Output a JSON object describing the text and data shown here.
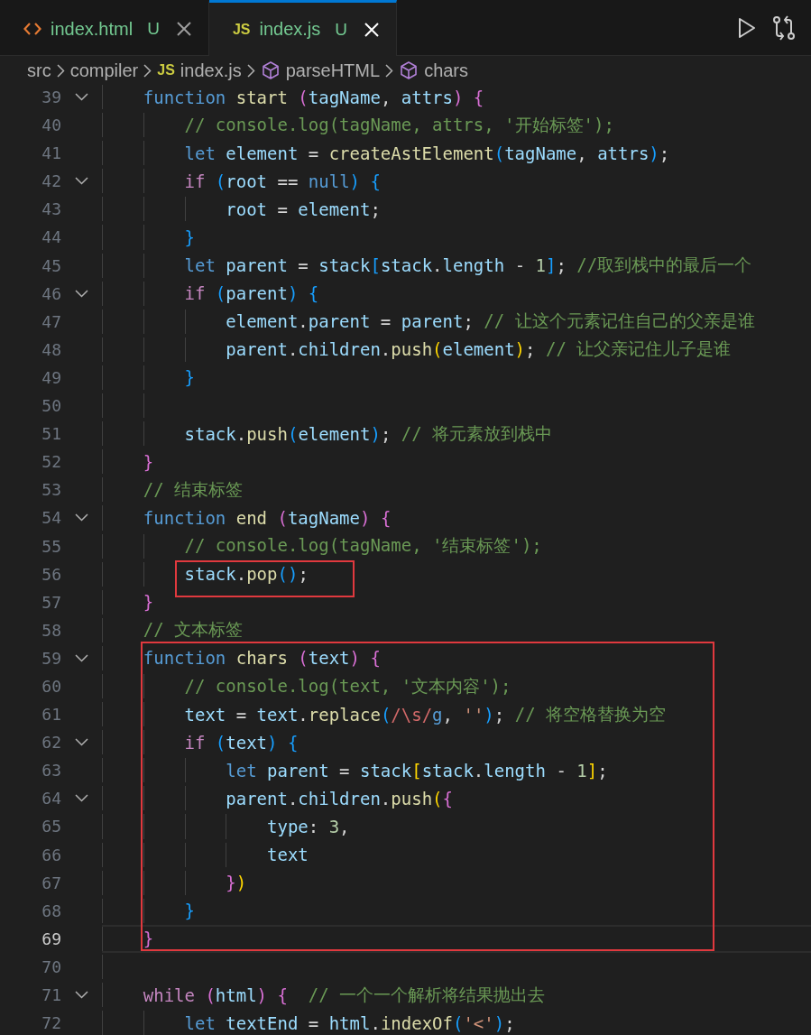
{
  "tabs": [
    {
      "kind": "html",
      "label": "index.html",
      "status": "U",
      "selected": false
    },
    {
      "kind": "js",
      "badge": "JS",
      "label": "index.js",
      "status": "U",
      "selected": true
    }
  ],
  "breadcrumb": [
    {
      "kind": "folder",
      "label": "src"
    },
    {
      "kind": "folder",
      "label": "compiler"
    },
    {
      "kind": "js",
      "badge": "JS",
      "label": "index.js"
    },
    {
      "kind": "symbol",
      "label": "parseHTML"
    },
    {
      "kind": "symbol",
      "label": "chars"
    }
  ],
  "segments": [
    {
      "boxed": false,
      "lines": [
        {
          "no": "39",
          "fold": true,
          "current": false,
          "tokens": [
            {
              "kind": "kw",
              "text": "    function"
            },
            {
              "kind": "fn",
              "text": " start "
            },
            {
              "kind": "br2",
              "text": "("
            },
            {
              "kind": "var",
              "text": "tagName"
            },
            {
              "kind": "pun",
              "text": ", "
            },
            {
              "kind": "var",
              "text": "attrs"
            },
            {
              "kind": "br2",
              "text": ")"
            },
            {
              "kind": "br2",
              "text": " {"
            }
          ]
        },
        {
          "no": "40",
          "fold": false,
          "current": false,
          "tokens": [
            {
              "kind": "com",
              "text": "        // console.log(tagName, attrs, '开始标签');"
            }
          ]
        },
        {
          "no": "41",
          "fold": false,
          "current": false,
          "tokens": [
            {
              "kind": "kw",
              "text": "        let"
            },
            {
              "kind": "var",
              "text": " element"
            },
            {
              "kind": "pun",
              "text": " = "
            },
            {
              "kind": "fn",
              "text": "createAstElement"
            },
            {
              "kind": "br3",
              "text": "("
            },
            {
              "kind": "var",
              "text": "tagName"
            },
            {
              "kind": "pun",
              "text": ", "
            },
            {
              "kind": "var",
              "text": "attrs"
            },
            {
              "kind": "br3",
              "text": ")"
            },
            {
              "kind": "pun",
              "text": ";"
            }
          ]
        },
        {
          "no": "42",
          "fold": true,
          "current": false,
          "tokens": [
            {
              "kind": "ctl",
              "text": "        if"
            },
            {
              "kind": "br3",
              "text": " ("
            },
            {
              "kind": "var",
              "text": "root"
            },
            {
              "kind": "pun",
              "text": " == "
            },
            {
              "kind": "kw",
              "text": "null"
            },
            {
              "kind": "br3",
              "text": ")"
            },
            {
              "kind": "br3",
              "text": " {"
            }
          ]
        },
        {
          "no": "43",
          "fold": false,
          "current": false,
          "tokens": [
            {
              "kind": "var",
              "text": "            root"
            },
            {
              "kind": "pun",
              "text": " = "
            },
            {
              "kind": "var",
              "text": "element"
            },
            {
              "kind": "pun",
              "text": ";"
            }
          ]
        },
        {
          "no": "44",
          "fold": false,
          "current": false,
          "tokens": [
            {
              "kind": "br3",
              "text": "        }"
            }
          ]
        },
        {
          "no": "45",
          "fold": false,
          "current": false,
          "tokens": [
            {
              "kind": "kw",
              "text": "        let"
            },
            {
              "kind": "var",
              "text": " parent"
            },
            {
              "kind": "pun",
              "text": " = "
            },
            {
              "kind": "var",
              "text": "stack"
            },
            {
              "kind": "br3",
              "text": "["
            },
            {
              "kind": "var",
              "text": "stack"
            },
            {
              "kind": "pun",
              "text": "."
            },
            {
              "kind": "var",
              "text": "length"
            },
            {
              "kind": "pun",
              "text": " - "
            },
            {
              "kind": "num",
              "text": "1"
            },
            {
              "kind": "br3",
              "text": "]"
            },
            {
              "kind": "pun",
              "text": "; "
            },
            {
              "kind": "com",
              "text": "//取到栈中的最后一个"
            }
          ]
        },
        {
          "no": "46",
          "fold": true,
          "current": false,
          "tokens": [
            {
              "kind": "ctl",
              "text": "        if"
            },
            {
              "kind": "br3",
              "text": " ("
            },
            {
              "kind": "var",
              "text": "parent"
            },
            {
              "kind": "br3",
              "text": ")"
            },
            {
              "kind": "br3",
              "text": " {"
            }
          ]
        },
        {
          "no": "47",
          "fold": false,
          "current": false,
          "tokens": [
            {
              "kind": "var",
              "text": "            element"
            },
            {
              "kind": "pun",
              "text": "."
            },
            {
              "kind": "var",
              "text": "parent"
            },
            {
              "kind": "pun",
              "text": " = "
            },
            {
              "kind": "var",
              "text": "parent"
            },
            {
              "kind": "pun",
              "text": "; "
            },
            {
              "kind": "com",
              "text": "// 让这个元素记住自己的父亲是谁"
            }
          ]
        },
        {
          "no": "48",
          "fold": false,
          "current": false,
          "tokens": [
            {
              "kind": "var",
              "text": "            parent"
            },
            {
              "kind": "pun",
              "text": "."
            },
            {
              "kind": "var",
              "text": "children"
            },
            {
              "kind": "pun",
              "text": "."
            },
            {
              "kind": "fn",
              "text": "push"
            },
            {
              "kind": "br1",
              "text": "("
            },
            {
              "kind": "var",
              "text": "element"
            },
            {
              "kind": "br1",
              "text": ")"
            },
            {
              "kind": "pun",
              "text": "; "
            },
            {
              "kind": "com",
              "text": "// 让父亲记住儿子是谁"
            }
          ]
        },
        {
          "no": "49",
          "fold": false,
          "current": false,
          "tokens": [
            {
              "kind": "br3",
              "text": "        }"
            }
          ]
        },
        {
          "no": "50",
          "fold": false,
          "current": false
        },
        {
          "no": "51",
          "fold": false,
          "current": false,
          "tokens": [
            {
              "kind": "var",
              "text": "        stack"
            },
            {
              "kind": "pun",
              "text": "."
            },
            {
              "kind": "fn",
              "text": "push"
            },
            {
              "kind": "br3",
              "text": "("
            },
            {
              "kind": "var",
              "text": "element"
            },
            {
              "kind": "br3",
              "text": ")"
            },
            {
              "kind": "pun",
              "text": "; "
            },
            {
              "kind": "com",
              "text": "// 将元素放到栈中"
            }
          ]
        },
        {
          "no": "52",
          "fold": false,
          "current": false,
          "tokens": [
            {
              "kind": "br2",
              "text": "    }"
            }
          ]
        },
        {
          "no": "53",
          "fold": false,
          "current": false,
          "tokens": [
            {
              "kind": "com",
              "text": "    // 结束标签"
            }
          ]
        },
        {
          "no": "54",
          "fold": true,
          "current": false,
          "tokens": [
            {
              "kind": "kw",
              "text": "    function"
            },
            {
              "kind": "fn",
              "text": " end "
            },
            {
              "kind": "br2",
              "text": "("
            },
            {
              "kind": "var",
              "text": "tagName"
            },
            {
              "kind": "br2",
              "text": ")"
            },
            {
              "kind": "br2",
              "text": " {"
            }
          ]
        },
        {
          "no": "55",
          "fold": false,
          "current": false,
          "tokens": [
            {
              "kind": "com",
              "text": "        // console.log(tagName, '结束标签');"
            }
          ]
        }
      ]
    },
    {
      "boxed": true,
      "lines": [
        {
          "no": "56",
          "fold": false,
          "current": false,
          "tokens": [
            {
              "kind": "var",
              "text": "        stack"
            },
            {
              "kind": "pun",
              "text": "."
            },
            {
              "kind": "fn",
              "text": "pop"
            },
            {
              "kind": "br3",
              "text": "("
            },
            {
              "kind": "br3",
              "text": ")"
            },
            {
              "kind": "pun",
              "text": ";"
            }
          ]
        }
      ]
    },
    {
      "boxed": false,
      "lines": [
        {
          "no": "57",
          "fold": false,
          "current": false,
          "tokens": [
            {
              "kind": "br2",
              "text": "    }"
            }
          ]
        },
        {
          "no": "58",
          "fold": false,
          "current": false,
          "tokens": [
            {
              "kind": "com",
              "text": "    // 文本标签"
            }
          ]
        }
      ]
    },
    {
      "boxed": true,
      "lines": [
        {
          "no": "59",
          "fold": true,
          "current": false,
          "tokens": [
            {
              "kind": "kw",
              "text": "    function"
            },
            {
              "kind": "fn",
              "text": " chars "
            },
            {
              "kind": "br2",
              "text": "("
            },
            {
              "kind": "var",
              "text": "text"
            },
            {
              "kind": "br2",
              "text": ")"
            },
            {
              "kind": "br2",
              "text": " {"
            }
          ]
        },
        {
          "no": "60",
          "fold": false,
          "current": false,
          "tokens": [
            {
              "kind": "com",
              "text": "        // console.log(text, '文本内容');"
            }
          ]
        },
        {
          "no": "61",
          "fold": false,
          "current": false,
          "tokens": [
            {
              "kind": "var",
              "text": "        text"
            },
            {
              "kind": "pun",
              "text": " = "
            },
            {
              "kind": "var",
              "text": "text"
            },
            {
              "kind": "pun",
              "text": "."
            },
            {
              "kind": "fn",
              "text": "replace"
            },
            {
              "kind": "br3",
              "text": "("
            },
            {
              "kind": "re",
              "text": "/\\s/"
            },
            {
              "kind": "kw",
              "text": "g"
            },
            {
              "kind": "pun",
              "text": ", "
            },
            {
              "kind": "str",
              "text": "''"
            },
            {
              "kind": "br3",
              "text": ")"
            },
            {
              "kind": "pun",
              "text": "; "
            },
            {
              "kind": "com",
              "text": "// 将空格替换为空"
            }
          ]
        },
        {
          "no": "62",
          "fold": true,
          "current": false,
          "tokens": [
            {
              "kind": "ctl",
              "text": "        if"
            },
            {
              "kind": "br3",
              "text": " ("
            },
            {
              "kind": "var",
              "text": "text"
            },
            {
              "kind": "br3",
              "text": ")"
            },
            {
              "kind": "br3",
              "text": " {"
            }
          ]
        },
        {
          "no": "63",
          "fold": false,
          "current": false,
          "tokens": [
            {
              "kind": "kw",
              "text": "            let"
            },
            {
              "kind": "var",
              "text": " parent"
            },
            {
              "kind": "pun",
              "text": " = "
            },
            {
              "kind": "var",
              "text": "stack"
            },
            {
              "kind": "br1",
              "text": "["
            },
            {
              "kind": "var",
              "text": "stack"
            },
            {
              "kind": "pun",
              "text": "."
            },
            {
              "kind": "var",
              "text": "length"
            },
            {
              "kind": "pun",
              "text": " - "
            },
            {
              "kind": "num",
              "text": "1"
            },
            {
              "kind": "br1",
              "text": "]"
            },
            {
              "kind": "pun",
              "text": ";"
            }
          ]
        },
        {
          "no": "64",
          "fold": true,
          "current": false,
          "tokens": [
            {
              "kind": "var",
              "text": "            parent"
            },
            {
              "kind": "pun",
              "text": "."
            },
            {
              "kind": "var",
              "text": "children"
            },
            {
              "kind": "pun",
              "text": "."
            },
            {
              "kind": "fn",
              "text": "push"
            },
            {
              "kind": "br1",
              "text": "("
            },
            {
              "kind": "br2",
              "text": "{"
            }
          ]
        },
        {
          "no": "65",
          "fold": false,
          "current": false,
          "tokens": [
            {
              "kind": "var",
              "text": "                type"
            },
            {
              "kind": "pun",
              "text": ": "
            },
            {
              "kind": "num",
              "text": "3"
            },
            {
              "kind": "pun",
              "text": ","
            }
          ]
        },
        {
          "no": "66",
          "fold": false,
          "current": false,
          "tokens": [
            {
              "kind": "var",
              "text": "                text"
            }
          ]
        },
        {
          "no": "67",
          "fold": false,
          "current": false,
          "tokens": [
            {
              "kind": "br2",
              "text": "            }"
            },
            {
              "kind": "br1",
              "text": ")"
            }
          ]
        },
        {
          "no": "68",
          "fold": false,
          "current": false,
          "tokens": [
            {
              "kind": "br3",
              "text": "        }"
            }
          ]
        },
        {
          "no": "69",
          "fold": false,
          "current": true,
          "tokens": [
            {
              "kind": "br2",
              "text": "    }"
            }
          ]
        }
      ]
    },
    {
      "boxed": false,
      "lines": [
        {
          "no": "70",
          "fold": false,
          "current": false
        },
        {
          "no": "71",
          "fold": true,
          "current": false,
          "tokens": [
            {
              "kind": "ctl",
              "text": "    while"
            },
            {
              "kind": "br2",
              "text": " ("
            },
            {
              "kind": "var",
              "text": "html"
            },
            {
              "kind": "br2",
              "text": ")"
            },
            {
              "kind": "br2",
              "text": " {"
            },
            {
              "kind": "com",
              "text": "  // 一个一个解析将结果抛出去"
            }
          ]
        },
        {
          "no": "72",
          "fold": false,
          "current": false,
          "tokens": [
            {
              "kind": "kw",
              "text": "        let"
            },
            {
              "kind": "var",
              "text": " textEnd"
            },
            {
              "kind": "pun",
              "text": " = "
            },
            {
              "kind": "var",
              "text": "html"
            },
            {
              "kind": "pun",
              "text": "."
            },
            {
              "kind": "fn",
              "text": "indexOf"
            },
            {
              "kind": "br3",
              "text": "("
            },
            {
              "kind": "str",
              "text": "'<'"
            },
            {
              "kind": "br3",
              "text": ")"
            },
            {
              "kind": "pun",
              "text": ";"
            }
          ]
        }
      ]
    }
  ]
}
